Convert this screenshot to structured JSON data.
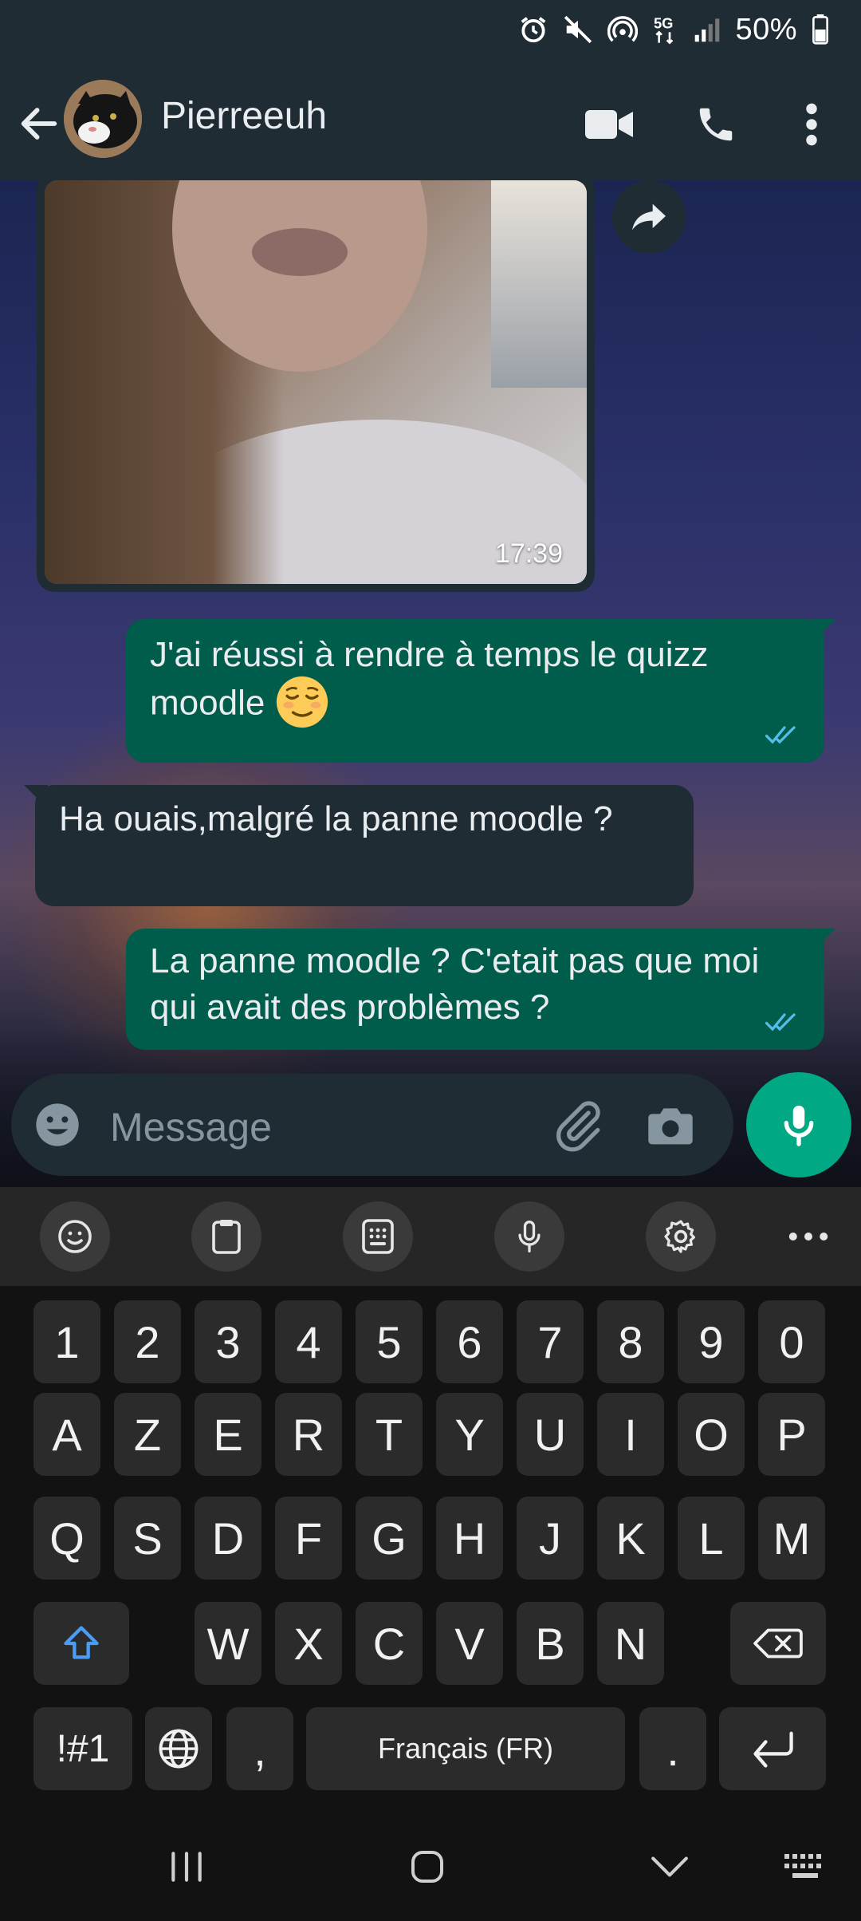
{
  "status_bar": {
    "battery_percent": "50%",
    "icons": [
      "alarm-icon",
      "mute-icon",
      "hotspot-icon",
      "5g-icon",
      "signal-icon",
      "battery-icon"
    ]
  },
  "header": {
    "contact_name": "Pierreeuh",
    "icons": [
      "back-arrow-icon",
      "video-call-icon",
      "phone-call-icon",
      "more-options-icon"
    ]
  },
  "chat": {
    "photo_message": {
      "time": "17:39"
    },
    "messages": [
      {
        "direction": "out",
        "text": "J'ai réussi à rendre à temps le quizz moodle",
        "emoji": "relieved-face",
        "status": "read"
      },
      {
        "direction": "in",
        "text": "Ha ouais,malgré la panne moodle ?"
      },
      {
        "direction": "out",
        "text": "La panne moodle ? C'etait pas que moi qui avait des problèmes ?",
        "status": "read"
      }
    ]
  },
  "composer": {
    "placeholder": "Message"
  },
  "keyboard": {
    "toolbar": [
      "emoji-icon",
      "clipboard-icon",
      "keypad-icon",
      "mic-icon",
      "settings-icon",
      "more-icon"
    ],
    "rows": [
      [
        "1",
        "2",
        "3",
        "4",
        "5",
        "6",
        "7",
        "8",
        "9",
        "0"
      ],
      [
        "A",
        "Z",
        "E",
        "R",
        "T",
        "Y",
        "U",
        "I",
        "O",
        "P"
      ],
      [
        "Q",
        "S",
        "D",
        "F",
        "G",
        "H",
        "J",
        "K",
        "L",
        "M"
      ],
      [
        "W",
        "X",
        "C",
        "V",
        "B",
        "N"
      ]
    ],
    "symbols_key": "!#1",
    "comma_key": ",",
    "space_label": "Français (FR)",
    "period_key": "."
  },
  "colors": {
    "header_bg": "#1f2c33",
    "outgoing_bubble": "#005c4b",
    "incoming_bubble": "#1f2c33",
    "accent": "#00a884",
    "read_ticks": "#53bdeb"
  }
}
